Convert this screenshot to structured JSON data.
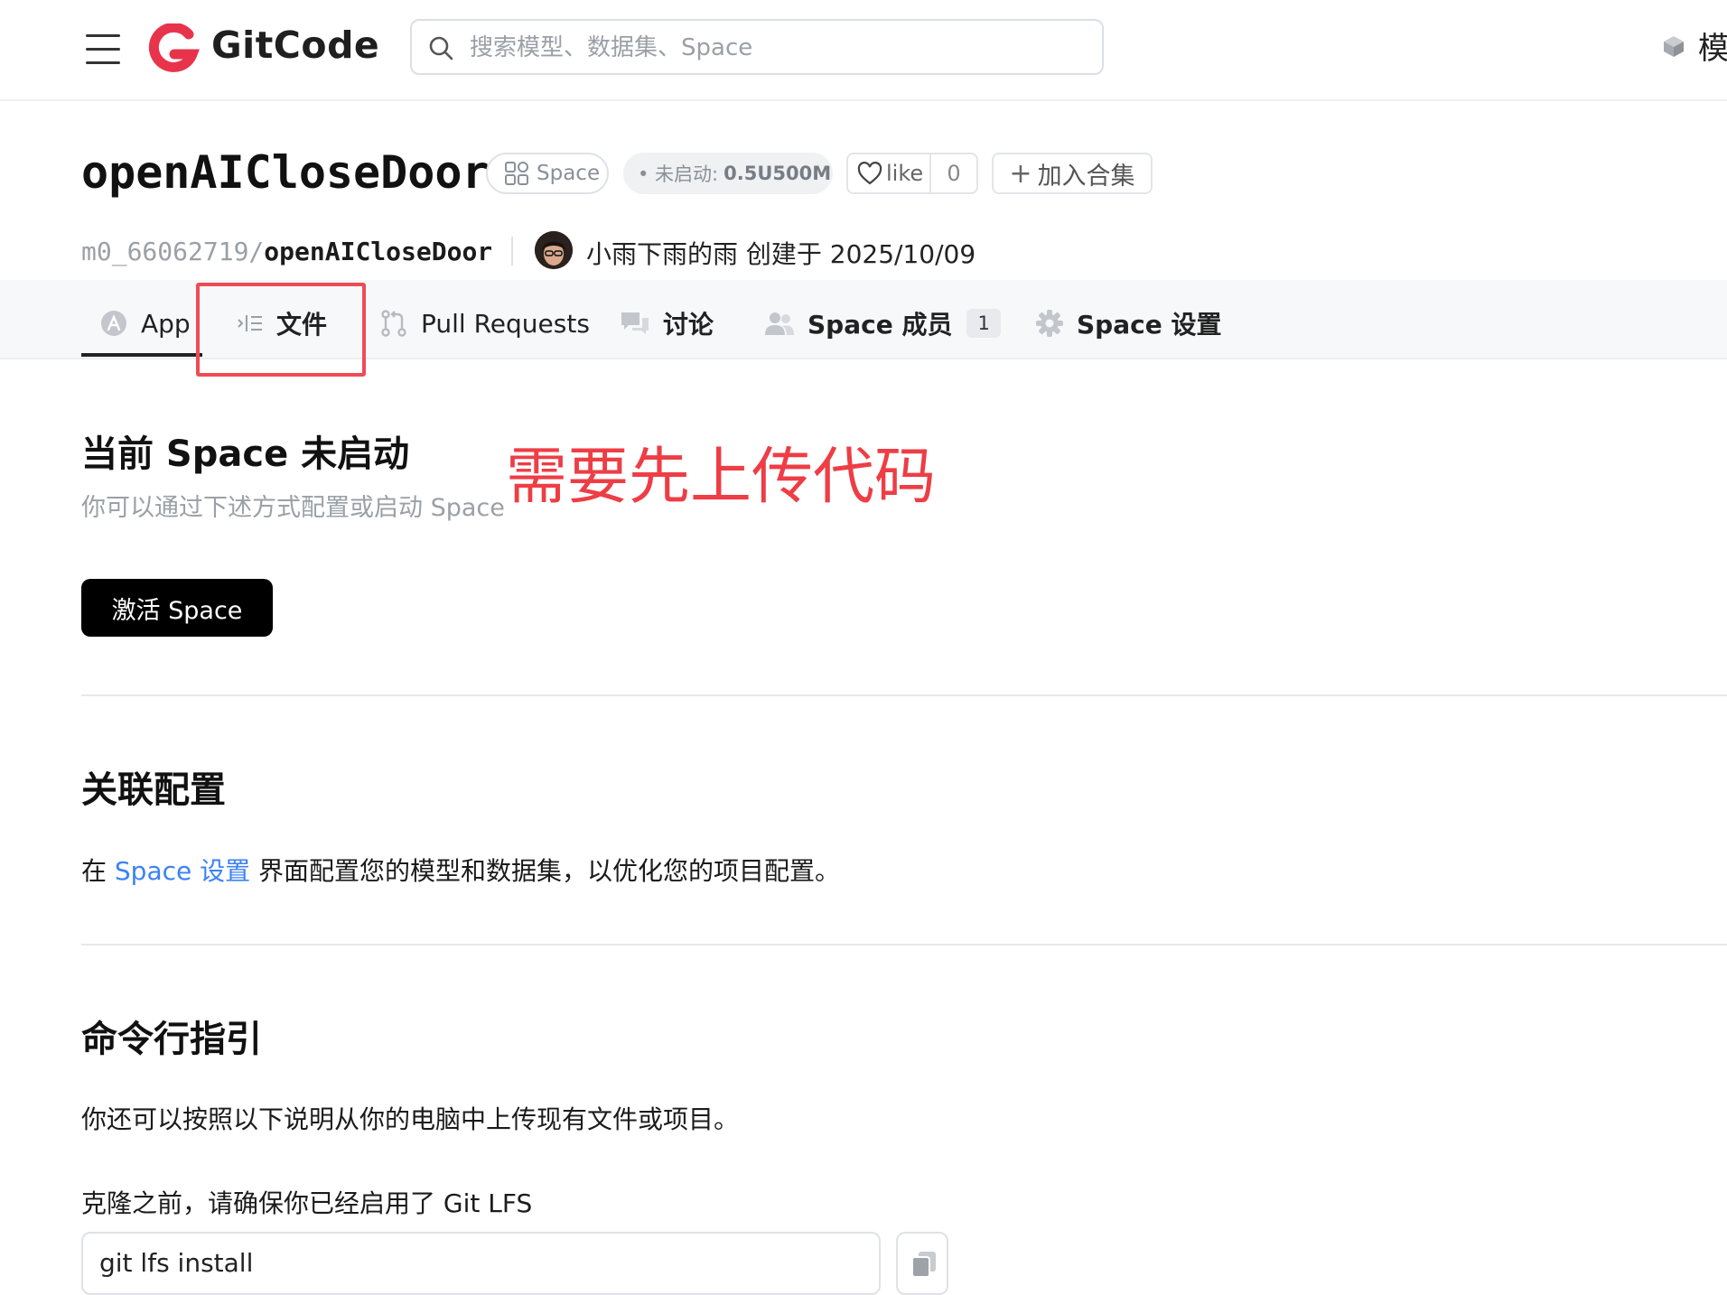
{
  "header": {
    "brand": "GitCode",
    "search_placeholder": "搜索模型、数据集、Space",
    "models_link": "模"
  },
  "project": {
    "title": "openAICloseDoor",
    "type_chip": "Space",
    "status_label": "• 未启动:",
    "status_value": "0.5U500M",
    "like_label": "like",
    "like_count": "0",
    "collect_label": "加入合集",
    "owner": "m0_66062719/",
    "repo": "openAICloseDoor",
    "creator_text": "小雨下雨的雨 创建于 2025/10/09"
  },
  "tabs": [
    {
      "label": "App",
      "icon": "app-icon"
    },
    {
      "label": "文件",
      "icon": "files-icon"
    },
    {
      "label": "Pull Requests",
      "icon": "pull-request-icon"
    },
    {
      "label": "讨论",
      "icon": "discussion-icon"
    },
    {
      "label": "Space 成员",
      "icon": "members-icon",
      "count": "1"
    },
    {
      "label": "Space 设置",
      "icon": "gear-icon"
    }
  ],
  "annotation": "需要先上传代码",
  "status_section": {
    "heading": "当前 Space 未启动",
    "subtitle": "你可以通过下述方式配置或启动 Space",
    "activate_button": "激活 Space"
  },
  "config_section": {
    "heading": "关联配置",
    "text_prefix": "在 ",
    "link": "Space 设置",
    "text_suffix": " 界面配置您的模型和数据集，以优化您的项目配置。"
  },
  "cli_section": {
    "heading": "命令行指引",
    "intro": "你还可以按照以下说明从你的电脑中上传现有文件或项目。",
    "lfs_note": "克隆之前，请确保你已经启用了 Git LFS",
    "command": "git lfs install"
  },
  "colors": {
    "accent_link": "#3b82f6",
    "annotation_red": "#ee3d45",
    "logo_red": "#e8344a"
  }
}
